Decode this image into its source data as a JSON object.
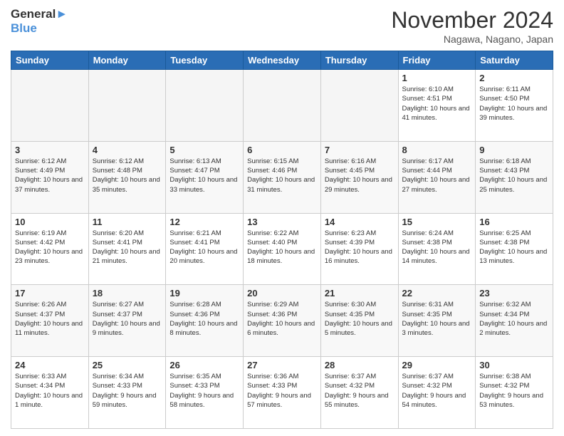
{
  "header": {
    "logo_line1": "General",
    "logo_line2": "Blue",
    "month_title": "November 2024",
    "location": "Nagawa, Nagano, Japan"
  },
  "weekdays": [
    "Sunday",
    "Monday",
    "Tuesday",
    "Wednesday",
    "Thursday",
    "Friday",
    "Saturday"
  ],
  "weeks": [
    [
      {
        "day": "",
        "info": ""
      },
      {
        "day": "",
        "info": ""
      },
      {
        "day": "",
        "info": ""
      },
      {
        "day": "",
        "info": ""
      },
      {
        "day": "",
        "info": ""
      },
      {
        "day": "1",
        "info": "Sunrise: 6:10 AM\nSunset: 4:51 PM\nDaylight: 10 hours\nand 41 minutes."
      },
      {
        "day": "2",
        "info": "Sunrise: 6:11 AM\nSunset: 4:50 PM\nDaylight: 10 hours\nand 39 minutes."
      }
    ],
    [
      {
        "day": "3",
        "info": "Sunrise: 6:12 AM\nSunset: 4:49 PM\nDaylight: 10 hours\nand 37 minutes."
      },
      {
        "day": "4",
        "info": "Sunrise: 6:12 AM\nSunset: 4:48 PM\nDaylight: 10 hours\nand 35 minutes."
      },
      {
        "day": "5",
        "info": "Sunrise: 6:13 AM\nSunset: 4:47 PM\nDaylight: 10 hours\nand 33 minutes."
      },
      {
        "day": "6",
        "info": "Sunrise: 6:15 AM\nSunset: 4:46 PM\nDaylight: 10 hours\nand 31 minutes."
      },
      {
        "day": "7",
        "info": "Sunrise: 6:16 AM\nSunset: 4:45 PM\nDaylight: 10 hours\nand 29 minutes."
      },
      {
        "day": "8",
        "info": "Sunrise: 6:17 AM\nSunset: 4:44 PM\nDaylight: 10 hours\nand 27 minutes."
      },
      {
        "day": "9",
        "info": "Sunrise: 6:18 AM\nSunset: 4:43 PM\nDaylight: 10 hours\nand 25 minutes."
      }
    ],
    [
      {
        "day": "10",
        "info": "Sunrise: 6:19 AM\nSunset: 4:42 PM\nDaylight: 10 hours\nand 23 minutes."
      },
      {
        "day": "11",
        "info": "Sunrise: 6:20 AM\nSunset: 4:41 PM\nDaylight: 10 hours\nand 21 minutes."
      },
      {
        "day": "12",
        "info": "Sunrise: 6:21 AM\nSunset: 4:41 PM\nDaylight: 10 hours\nand 20 minutes."
      },
      {
        "day": "13",
        "info": "Sunrise: 6:22 AM\nSunset: 4:40 PM\nDaylight: 10 hours\nand 18 minutes."
      },
      {
        "day": "14",
        "info": "Sunrise: 6:23 AM\nSunset: 4:39 PM\nDaylight: 10 hours\nand 16 minutes."
      },
      {
        "day": "15",
        "info": "Sunrise: 6:24 AM\nSunset: 4:38 PM\nDaylight: 10 hours\nand 14 minutes."
      },
      {
        "day": "16",
        "info": "Sunrise: 6:25 AM\nSunset: 4:38 PM\nDaylight: 10 hours\nand 13 minutes."
      }
    ],
    [
      {
        "day": "17",
        "info": "Sunrise: 6:26 AM\nSunset: 4:37 PM\nDaylight: 10 hours\nand 11 minutes."
      },
      {
        "day": "18",
        "info": "Sunrise: 6:27 AM\nSunset: 4:37 PM\nDaylight: 10 hours\nand 9 minutes."
      },
      {
        "day": "19",
        "info": "Sunrise: 6:28 AM\nSunset: 4:36 PM\nDaylight: 10 hours\nand 8 minutes."
      },
      {
        "day": "20",
        "info": "Sunrise: 6:29 AM\nSunset: 4:36 PM\nDaylight: 10 hours\nand 6 minutes."
      },
      {
        "day": "21",
        "info": "Sunrise: 6:30 AM\nSunset: 4:35 PM\nDaylight: 10 hours\nand 5 minutes."
      },
      {
        "day": "22",
        "info": "Sunrise: 6:31 AM\nSunset: 4:35 PM\nDaylight: 10 hours\nand 3 minutes."
      },
      {
        "day": "23",
        "info": "Sunrise: 6:32 AM\nSunset: 4:34 PM\nDaylight: 10 hours\nand 2 minutes."
      }
    ],
    [
      {
        "day": "24",
        "info": "Sunrise: 6:33 AM\nSunset: 4:34 PM\nDaylight: 10 hours\nand 1 minute."
      },
      {
        "day": "25",
        "info": "Sunrise: 6:34 AM\nSunset: 4:33 PM\nDaylight: 9 hours\nand 59 minutes."
      },
      {
        "day": "26",
        "info": "Sunrise: 6:35 AM\nSunset: 4:33 PM\nDaylight: 9 hours\nand 58 minutes."
      },
      {
        "day": "27",
        "info": "Sunrise: 6:36 AM\nSunset: 4:33 PM\nDaylight: 9 hours\nand 57 minutes."
      },
      {
        "day": "28",
        "info": "Sunrise: 6:37 AM\nSunset: 4:32 PM\nDaylight: 9 hours\nand 55 minutes."
      },
      {
        "day": "29",
        "info": "Sunrise: 6:37 AM\nSunset: 4:32 PM\nDaylight: 9 hours\nand 54 minutes."
      },
      {
        "day": "30",
        "info": "Sunrise: 6:38 AM\nSunset: 4:32 PM\nDaylight: 9 hours\nand 53 minutes."
      }
    ]
  ]
}
